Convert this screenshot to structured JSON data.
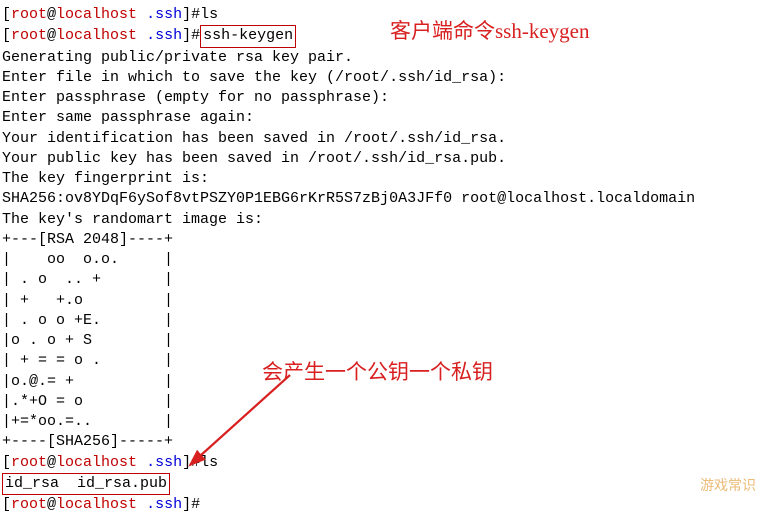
{
  "prompt": {
    "user": "root",
    "host": "localhost",
    "path": ".ssh",
    "symbol": "#"
  },
  "commands": {
    "ls1": "ls",
    "sshkeygen": "ssh-keygen",
    "ls2": "ls"
  },
  "output": {
    "l1": "Generating public/private rsa key pair.",
    "l2": "Enter file in which to save the key (/root/.ssh/id_rsa):",
    "l3": "Enter passphrase (empty for no passphrase):",
    "l4": "Enter same passphrase again:",
    "l5": "Your identification has been saved in /root/.ssh/id_rsa.",
    "l6": "Your public key has been saved in /root/.ssh/id_rsa.pub.",
    "l7": "The key fingerprint is:",
    "l8": "SHA256:ov8YDqF6ySof8vtPSZY0P1EBG6rKrR5S7zBj0A3JFf0 root@localhost.localdomain",
    "l9": "The key's randomart image is:",
    "r01": "+---[RSA 2048]----+",
    "r02": "|    oo  o.o.     |",
    "r03": "| . o  .. +       |",
    "r04": "| +   +.o         |",
    "r05": "| . o o +E.       |",
    "r06": "|o . o + S        |",
    "r07": "| + = = o .       |",
    "r08": "|o.@.= +          |",
    "r09": "|.*+O = o         |",
    "r10": "|+=*oo.=..        |",
    "r11": "+----[SHA256]-----+"
  },
  "ls_result": "id_rsa  id_rsa.pub",
  "annotations": {
    "top": "客户端命令ssh-keygen",
    "side": "会产生一个公钥一个私钥",
    "watermark": "游戏常识"
  }
}
